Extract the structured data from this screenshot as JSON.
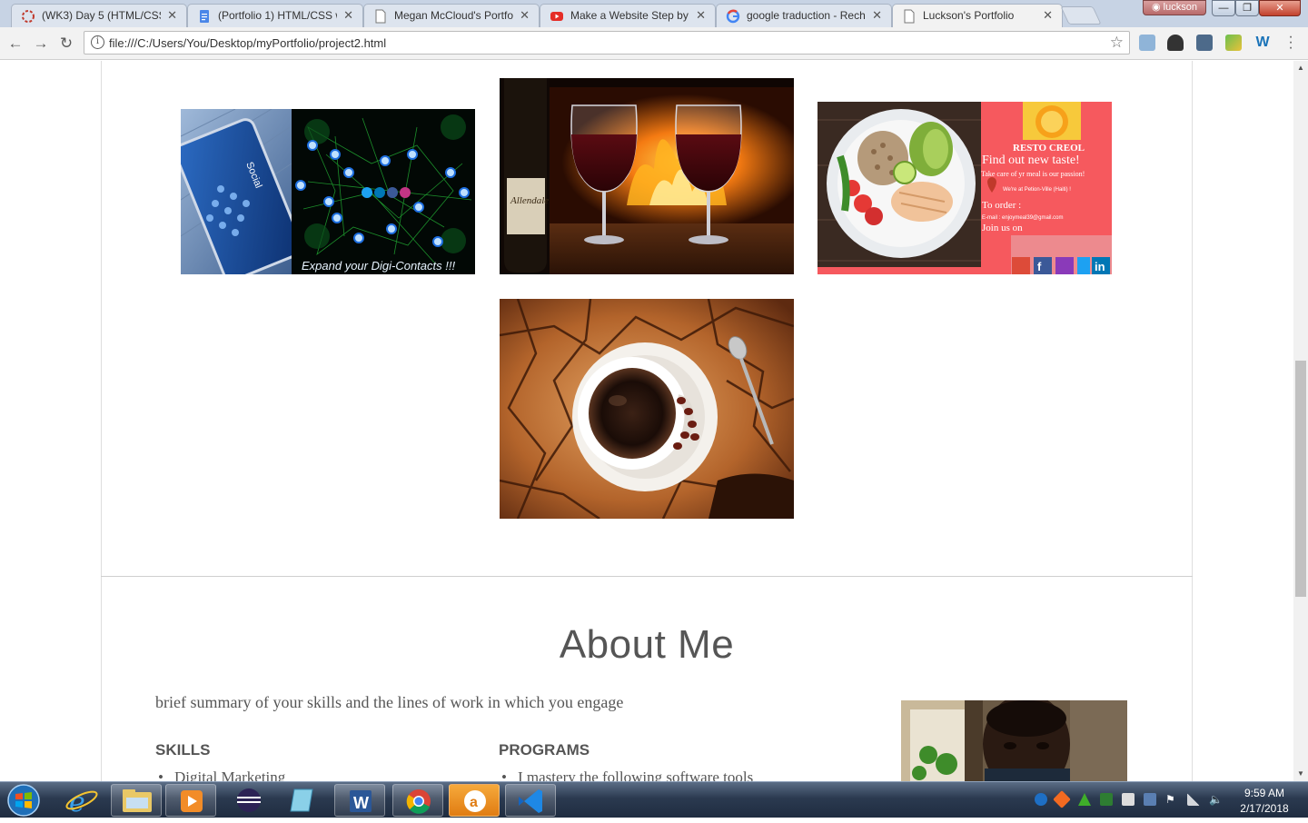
{
  "browser": {
    "tabs": [
      {
        "title": "(WK3) Day 5 (HTML/CSS",
        "icon": "spinner-icon",
        "active": false
      },
      {
        "title": "(Portfolio 1) HTML/CSS w",
        "icon": "docs-icon",
        "active": false
      },
      {
        "title": "Megan McCloud's Portfol",
        "icon": "page-icon",
        "active": false
      },
      {
        "title": "Make a Website Step by",
        "icon": "youtube-icon",
        "active": false
      },
      {
        "title": "google traduction - Rech",
        "icon": "google-icon",
        "active": false
      },
      {
        "title": "Luckson's Portfolio",
        "icon": "page-icon",
        "active": true
      }
    ],
    "user_label": "luckson",
    "url": "file:///C:/Users/You/Desktop/myPortfolio/project2.html",
    "tab_close_glyph": "✕",
    "win_min": "—",
    "win_max": "❐",
    "win_close": "✕"
  },
  "page": {
    "gallery": [
      {
        "name": "social-network-thumbnail",
        "caption": "Expand your Digi-Contacts !!!",
        "phone_text": "Social"
      },
      {
        "name": "wine-fireplace-thumbnail",
        "label": "Allendale"
      },
      {
        "name": "resto-creol-thumbnail",
        "brand": "RESTO CREOL",
        "headline": "Find out new taste!",
        "tagline": "Take care of yr meal is our passion!",
        "location": "We're at Petion-Ville (Haiti) !",
        "order": "To order :",
        "email": "E-mail : enjoymeal39@gmail.com",
        "join": "Join us on"
      },
      {
        "name": "coffee-cup-thumbnail"
      }
    ],
    "about_title": "About Me",
    "summary": "brief summary of your skills and the lines of work in which you engage",
    "skills_heading": "SKILLS",
    "programs_heading": "PROGRAMS",
    "skills_first": "Digital Marketing",
    "programs_first": "I mastery the following software tools"
  },
  "taskbar": {
    "apps": [
      "start-orb",
      "internet-explorer",
      "file-explorer",
      "media-player",
      "eclipse",
      "notepad",
      "word",
      "chrome",
      "avast",
      "vscode"
    ],
    "time": "9:59 AM",
    "date": "2/17/2018"
  },
  "colors": {
    "tab_active": "#f2f2f2",
    "tab_inactive": "#dde4ee",
    "frame": "#c7d3e4",
    "text": "#555555"
  }
}
